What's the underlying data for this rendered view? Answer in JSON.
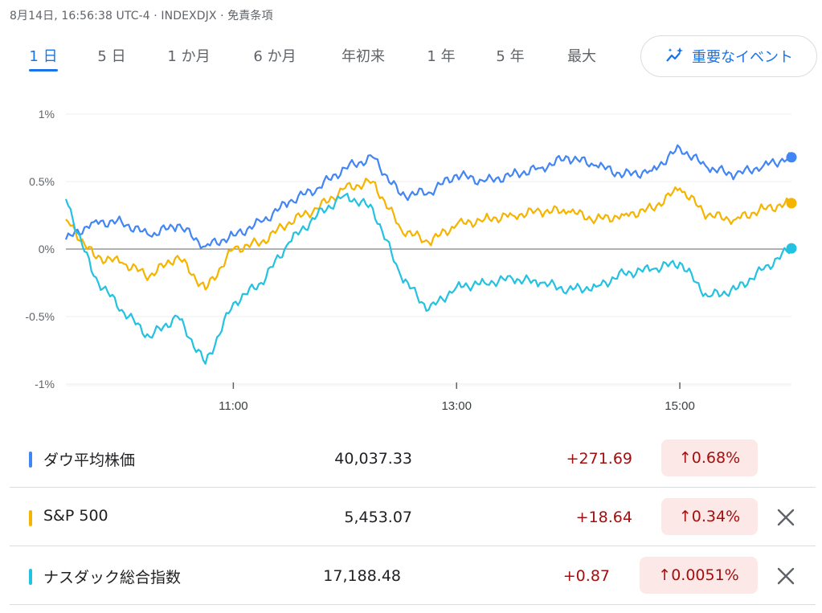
{
  "meta": "8月14日, 16:56:38 UTC-4 · INDEXDJX · 免責条項",
  "tabs": [
    {
      "label": "1 日",
      "active": true
    },
    {
      "label": "5 日",
      "active": false
    },
    {
      "label": "1 か月",
      "active": false
    },
    {
      "label": "6 か月",
      "active": false
    },
    {
      "label": "年初来",
      "active": false
    },
    {
      "label": "1 年",
      "active": false
    },
    {
      "label": "5 年",
      "active": false
    },
    {
      "label": "最大",
      "active": false
    }
  ],
  "events_button": {
    "label": "重要なイベント",
    "icon": "sparkle-chart-icon"
  },
  "chart_data": {
    "type": "line",
    "x_unit": "time",
    "x_range": [
      "09:30",
      "16:00"
    ],
    "xticks": [
      "11:00",
      "13:00",
      "15:00"
    ],
    "ylim": [
      -1,
      1
    ],
    "yticks": [
      "1%",
      "0.5%",
      "0%",
      "-0.5%",
      "-1%"
    ],
    "baseline": 0,
    "series": [
      {
        "name": "ダウ平均株価",
        "color": "#4285f4",
        "x": [
          "09:30",
          "09:45",
          "10:00",
          "10:15",
          "10:30",
          "10:45",
          "11:00",
          "11:15",
          "11:30",
          "11:45",
          "12:00",
          "12:15",
          "12:30",
          "12:45",
          "13:00",
          "13:15",
          "13:30",
          "13:45",
          "14:00",
          "14:15",
          "14:30",
          "14:45",
          "15:00",
          "15:15",
          "15:30",
          "15:45",
          "16:00"
        ],
        "values": [
          0.07,
          0.2,
          0.2,
          0.1,
          0.18,
          0.02,
          0.1,
          0.2,
          0.35,
          0.45,
          0.6,
          0.68,
          0.4,
          0.42,
          0.55,
          0.5,
          0.55,
          0.6,
          0.68,
          0.62,
          0.55,
          0.58,
          0.75,
          0.6,
          0.55,
          0.62,
          0.68
        ]
      },
      {
        "name": "S&P 500",
        "color": "#f4b400",
        "x": [
          "09:30",
          "09:45",
          "10:00",
          "10:15",
          "10:30",
          "10:45",
          "11:00",
          "11:15",
          "11:30",
          "11:45",
          "12:00",
          "12:15",
          "12:30",
          "12:45",
          "13:00",
          "13:15",
          "13:30",
          "13:45",
          "14:00",
          "14:15",
          "14:30",
          "14:45",
          "15:00",
          "15:15",
          "15:30",
          "15:45",
          "16:00"
        ],
        "values": [
          0.22,
          -0.05,
          -0.1,
          -0.2,
          -0.05,
          -0.3,
          0.0,
          0.05,
          0.2,
          0.3,
          0.45,
          0.5,
          0.15,
          0.05,
          0.18,
          0.22,
          0.25,
          0.28,
          0.28,
          0.22,
          0.25,
          0.3,
          0.45,
          0.25,
          0.22,
          0.3,
          0.34
        ]
      },
      {
        "name": "ナスダック総合指数",
        "color": "#24c1e0",
        "x": [
          "09:30",
          "09:45",
          "10:00",
          "10:15",
          "10:30",
          "10:45",
          "11:00",
          "11:15",
          "11:30",
          "11:45",
          "12:00",
          "12:15",
          "12:30",
          "12:45",
          "13:00",
          "13:15",
          "13:30",
          "13:45",
          "14:00",
          "14:15",
          "14:30",
          "14:45",
          "15:00",
          "15:15",
          "15:30",
          "15:45",
          "16:00"
        ],
        "values": [
          0.37,
          -0.2,
          -0.45,
          -0.65,
          -0.5,
          -0.85,
          -0.4,
          -0.25,
          0.05,
          0.25,
          0.4,
          0.3,
          -0.2,
          -0.45,
          -0.28,
          -0.25,
          -0.22,
          -0.25,
          -0.3,
          -0.28,
          -0.18,
          -0.15,
          -0.1,
          -0.35,
          -0.3,
          -0.15,
          0.0051
        ]
      }
    ]
  },
  "legend": [
    {
      "name": "ダウ平均株価",
      "value": "40,037.33",
      "change": "+271.69",
      "pct": "0.68%",
      "color": "#4285f4",
      "closable": false
    },
    {
      "name": "S&P 500",
      "value": "5,453.07",
      "change": "+18.64",
      "pct": "0.34%",
      "color": "#f4b400",
      "closable": true
    },
    {
      "name": "ナスダック総合指数",
      "value": "17,188.48",
      "change": "+0.87",
      "pct": "0.0051%",
      "color": "#24c1e0",
      "closable": true
    }
  ],
  "arrow": "↑"
}
